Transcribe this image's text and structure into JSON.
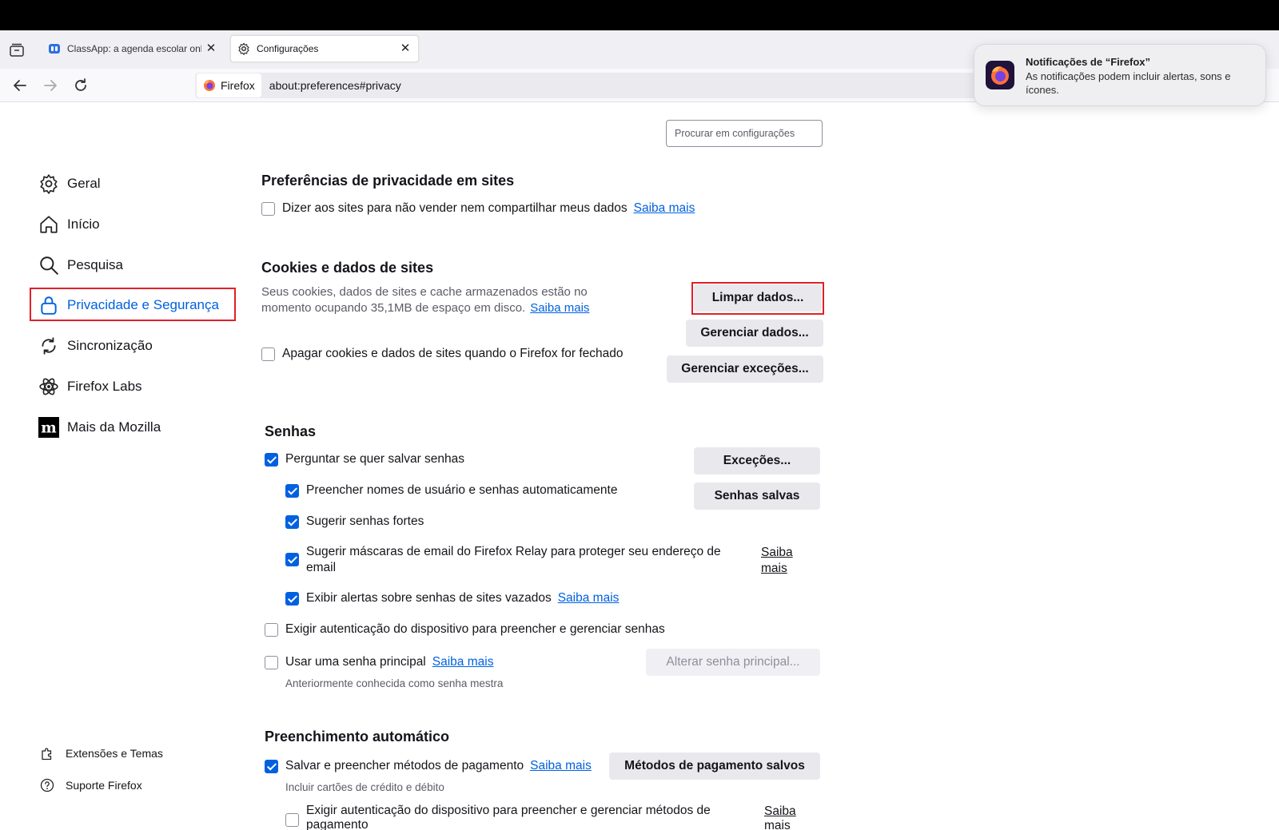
{
  "tabs": [
    {
      "label": "ClassApp: a agenda escolar online",
      "active": false
    },
    {
      "label": "Configurações",
      "active": true
    }
  ],
  "urlbar": {
    "identity": "Firefox",
    "url": "about:preferences#privacy"
  },
  "notification": {
    "title": "Notificações de “Firefox”",
    "body": "As notificações podem incluir alertas, sons e ícones."
  },
  "search": {
    "placeholder": "Procurar em configurações"
  },
  "sidebar": {
    "items": [
      {
        "label": "Geral",
        "icon": "gear-icon"
      },
      {
        "label": "Início",
        "icon": "home-icon"
      },
      {
        "label": "Pesquisa",
        "icon": "search-icon"
      },
      {
        "label": "Privacidade e Segurança",
        "icon": "lock-icon",
        "active": true
      },
      {
        "label": "Sincronização",
        "icon": "sync-icon"
      },
      {
        "label": "Firefox Labs",
        "icon": "labs-icon"
      },
      {
        "label": "Mais da Mozilla",
        "icon": "mozilla-icon"
      }
    ],
    "footer": [
      {
        "label": "Extensões e Temas",
        "icon": "puzzle-icon"
      },
      {
        "label": "Suporte Firefox",
        "icon": "help-icon"
      }
    ]
  },
  "privacy_prefs": {
    "title": "Preferências de privacidade em sites",
    "gpc_label": "Dizer aos sites para não vender nem compartilhar meus dados",
    "gpc_link": "Saiba mais"
  },
  "cookies": {
    "title": "Cookies e dados de sites",
    "desc_line1": "Seus cookies, dados de sites e cache armazenados estão no",
    "desc_line2": "momento ocupando 35,1MB de espaço em disco.",
    "desc_link": "Saiba mais",
    "clear_button": "Limpar dados...",
    "manage_button": "Gerenciar dados...",
    "exceptions_button": "Gerenciar exceções...",
    "delete_on_close_label": "Apagar cookies e dados de sites quando o Firefox for fechado"
  },
  "passwords": {
    "title": "Senhas",
    "ask_save_label": "Perguntar se quer salvar senhas",
    "autofill_label": "Preencher nomes de usuário e senhas automaticamente",
    "suggest_strong_label": "Sugerir senhas fortes",
    "relay_line1": "Sugerir máscaras de email do Firefox Relay para proteger seu endereço de",
    "relay_line2": "email",
    "relay_link_line1": "Saiba",
    "relay_link_line2": "mais",
    "breach_label": "Exibir alertas sobre senhas de sites vazados",
    "breach_link": "Saiba mais",
    "device_auth_label": "Exigir autenticação do dispositivo para preencher e gerenciar senhas",
    "primary_pw_label": "Usar uma senha principal",
    "primary_pw_link": "Saiba mais",
    "primary_pw_note": "Anteriormente conhecida como senha mestra",
    "exceptions_button": "Exceções...",
    "saved_button": "Senhas salvas",
    "change_primary_button": "Alterar senha principal..."
  },
  "autofill": {
    "title": "Preenchimento automático",
    "payment_label": "Salvar e preencher métodos de pagamento",
    "payment_link": "Saiba mais",
    "payment_note": "Incluir cartões de crédito e débito",
    "payment_button": "Métodos de pagamento salvos",
    "payment_auth_line1": "Exigir autenticação do dispositivo para preencher e gerenciar métodos de",
    "payment_auth_line2": "pagamento",
    "payment_auth_link_line1": "Saiba",
    "payment_auth_link_line2": "mais"
  },
  "colors": {
    "accent": "#0061e0",
    "highlight": "#e0202a"
  }
}
